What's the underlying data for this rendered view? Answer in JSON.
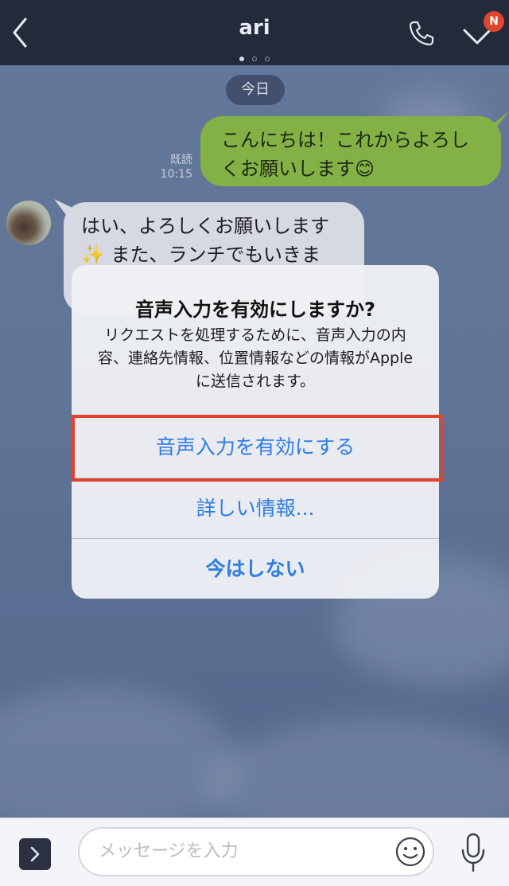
{
  "header": {
    "title": "ari",
    "badge": "N"
  },
  "chat": {
    "date_label": "今日",
    "messages": [
      {
        "side": "out",
        "text": "こんにちは！これからよろしくお願いします😊",
        "read": "既読",
        "time": "10:15"
      },
      {
        "side": "in",
        "text": "はい、よろしくお願いします✨ また、ランチでもいきま"
      }
    ]
  },
  "alert": {
    "title": "音声入力を有効にしますか?",
    "message": "リクエストを処理するために、音声入力の内容、連絡先情報、位置情報などの情報がAppleに送信されます。",
    "actions": [
      {
        "label": "音声入力を有効にする",
        "highlighted": true
      },
      {
        "label": "詳しい情報..."
      },
      {
        "label": "今はしない",
        "bold": true
      }
    ],
    "highlight_color": "#e2432d",
    "action_color": "#2f7de1"
  },
  "input_bar": {
    "placeholder": "メッセージを入力"
  },
  "icons": {
    "back": "chevron-left-icon",
    "call": "phone-icon",
    "menu": "chevron-down-icon",
    "expand": "chevron-right-icon",
    "emoji": "smiley-icon",
    "mic": "microphone-icon"
  },
  "colors": {
    "header_bg": "#232a3a",
    "outgoing_bubble": "#8cbd46",
    "incoming_bubble": "#e7e9ef",
    "badge": "#e0462f"
  }
}
